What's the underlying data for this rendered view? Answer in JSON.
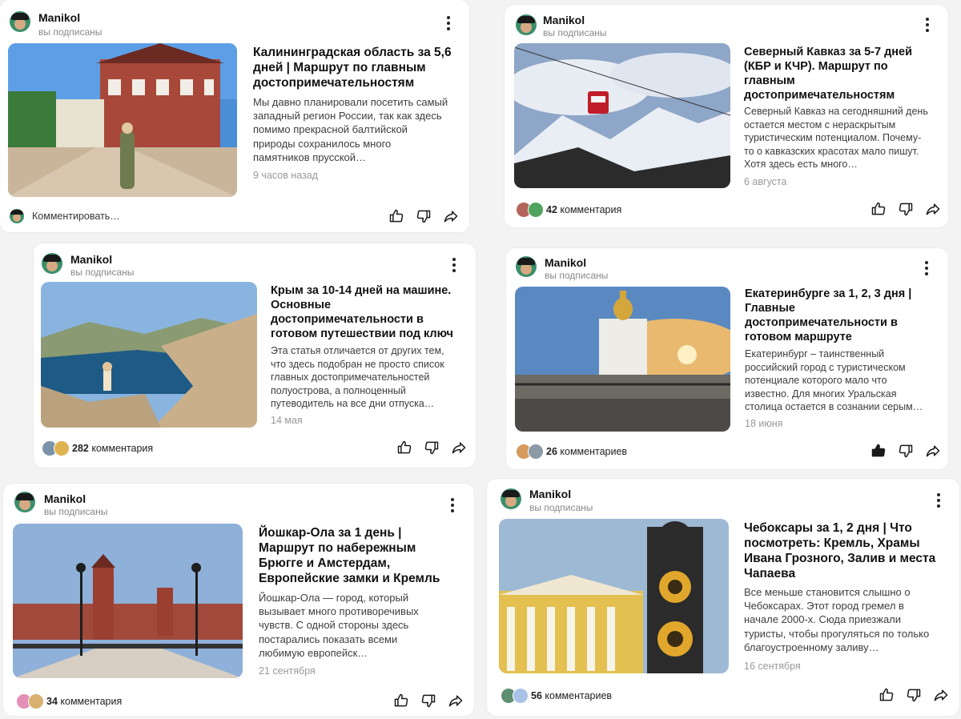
{
  "cards": [
    {
      "author": "Manikol",
      "subscribed": "вы подписаны",
      "title": "Калининградская область за 5,6 дней | Маршрут по главным достопримечательностям",
      "description": "Мы давно планировали посетить самый западный регион России, так как здесь помимо прекрасной балтийской природы сохранилось много памятников прусской…",
      "date": "9 часов назад",
      "comment_prompt": "Комментировать…"
    },
    {
      "author": "Manikol",
      "subscribed": "вы подписаны",
      "title": "Северный Кавказ за 5-7 дней (КБР и КЧР). Маршрут по главным достопримечательностям",
      "description": "Северный Кавказ на сегодняшний день остается местом с нераскрытым туристическим потенциалом. Почему-то о кавказских красотах мало пишут. Хотя здесь есть много…",
      "date": "6 августа",
      "comments_count": "42",
      "comments_word": "комментария"
    },
    {
      "author": "Manikol",
      "subscribed": "вы подписаны",
      "title": "Крым за 10-14 дней на машине. Основные достопримечательности в готовом путешествии под ключ",
      "description": "Эта статья отличается от других тем, что здесь подобран не просто список главных достопримечательностей полуострова, а полноценный путеводитель на все дни отпуска…",
      "date": "14 мая",
      "comments_count": "282",
      "comments_word": "комментария"
    },
    {
      "author": "Manikol",
      "subscribed": "вы подписаны",
      "title": "Екатеринбурге за 1, 2, 3 дня | Главные достопримечательности в готовом маршруте",
      "description": "Екатеринбург – таинственный российский город с туристическом потенциале которого мало что известно. Для многих Уральская столица остается в сознании серым…",
      "date": "18 июня",
      "comments_count": "26",
      "comments_word": "комментариев"
    },
    {
      "author": "Manikol",
      "subscribed": "вы подписаны",
      "title": "Йошкар-Ола за 1 день | Маршрут по набережным Брюгге и Амстердам, Европейские замки и Кремль",
      "description": "Йошкар-Ола — город, который вызывает много противоречивых чувств. С одной стороны здесь постарались показать всеми любимую европейск…",
      "date": "21 сентября",
      "comments_count": "34",
      "comments_word": "комментария"
    },
    {
      "author": "Manikol",
      "subscribed": "вы подписаны",
      "title": "Чебоксары за 1, 2 дня | Что посмотреть: Кремль, Храмы Ивана Грозного, Залив и места Чапаева",
      "description": "Все меньше становится слышно о Чебоксарах. Этот город гремел в начале 2000-х. Сюда приезжали туристы, чтобы прогуляться по только благоустроенному заливу…",
      "date": "16 сентября",
      "comments_count": "56",
      "comments_word": "комментариев"
    }
  ],
  "icons": {
    "like": "thumbs-up-icon",
    "dislike": "thumbs-down-icon",
    "share": "share-arrow-icon",
    "menu": "more-vertical-icon"
  }
}
